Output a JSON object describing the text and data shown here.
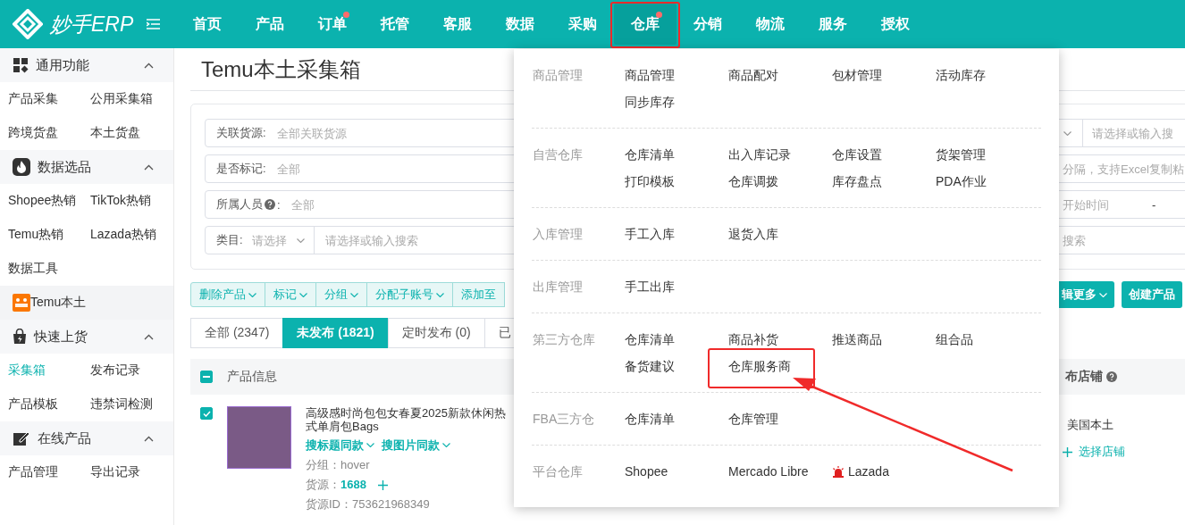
{
  "brand": "妙手ERP",
  "nav": [
    {
      "label": "首页",
      "selected": false,
      "dot": false,
      "highlighted": false
    },
    {
      "label": "产品",
      "selected": false,
      "dot": false,
      "highlighted": false
    },
    {
      "label": "订单",
      "selected": false,
      "dot": true,
      "highlighted": false
    },
    {
      "label": "托管",
      "selected": false,
      "dot": false,
      "highlighted": false
    },
    {
      "label": "客服",
      "selected": false,
      "dot": false,
      "highlighted": false
    },
    {
      "label": "数据",
      "selected": false,
      "dot": false,
      "highlighted": false
    },
    {
      "label": "采购",
      "selected": false,
      "dot": false,
      "highlighted": false
    },
    {
      "label": "仓库",
      "selected": true,
      "dot": true,
      "highlighted": true
    },
    {
      "label": "分销",
      "selected": false,
      "dot": false,
      "highlighted": false
    },
    {
      "label": "物流",
      "selected": false,
      "dot": false,
      "highlighted": false
    },
    {
      "label": "服务",
      "selected": false,
      "dot": false,
      "highlighted": false
    },
    {
      "label": "授权",
      "selected": false,
      "dot": false,
      "highlighted": false
    }
  ],
  "sidebar": [
    {
      "kind": "section",
      "title": "通用功能",
      "expanded": true,
      "items": [
        {
          "label": "产品采集",
          "selected": false
        },
        {
          "label": "公用采集箱",
          "selected": false
        },
        {
          "label": "跨境货盘",
          "selected": false
        },
        {
          "label": "本土货盘",
          "selected": false
        }
      ]
    },
    {
      "kind": "section",
      "title": "数据选品",
      "expanded": true,
      "items": [
        {
          "label": "Shopee热销",
          "selected": false
        },
        {
          "label": "TikTok热销",
          "selected": false
        },
        {
          "label": "Temu热销",
          "selected": false
        },
        {
          "label": "Lazada热销",
          "selected": false
        },
        {
          "label": "数据工具",
          "selected": false
        }
      ]
    },
    {
      "kind": "brand-link",
      "title": "Temu本土"
    },
    {
      "kind": "section",
      "title": "快速上货",
      "expanded": true,
      "items": [
        {
          "label": "采集箱",
          "selected": true
        },
        {
          "label": "发布记录",
          "selected": false
        },
        {
          "label": "产品模板",
          "selected": false
        },
        {
          "label": "违禁词检测",
          "selected": false
        }
      ]
    },
    {
      "kind": "section",
      "title": "在线产品",
      "expanded": true,
      "items": [
        {
          "label": "产品管理",
          "selected": false
        },
        {
          "label": "导出记录",
          "selected": false
        }
      ]
    }
  ],
  "page_title": "Temu本土采集箱",
  "filters": [
    {
      "kind": "select",
      "label": "关联货源:",
      "placeholder": "全部关联货源",
      "right": {
        "kind": "select-search",
        "placeholder": "请选择或输入搜"
      }
    },
    {
      "kind": "select",
      "label": "是否标记:",
      "placeholder": "全部",
      "right": {
        "kind": "text",
        "placeholder": "分隔，支持Excel复制粘"
      }
    },
    {
      "kind": "select",
      "label": "所属人员",
      "label_end": ":",
      "help": true,
      "placeholder": "全部",
      "right": {
        "kind": "date-range",
        "placeholder": "开始时间",
        "separator": "-"
      }
    },
    {
      "kind": "category",
      "label": "类目:",
      "select_placeholder": "请选择",
      "placeholder": "请选择或输入搜索",
      "right": {
        "kind": "text",
        "placeholder": "搜索"
      }
    }
  ],
  "actions": [
    {
      "label": "删除产品",
      "dropdown": true
    },
    {
      "label": "标记",
      "dropdown": true
    },
    {
      "label": "分组",
      "dropdown": true
    },
    {
      "label": "分配子账号",
      "dropdown": true
    },
    {
      "label": "添加至",
      "dropdown": false
    }
  ],
  "right_actions": [
    {
      "label": "辑更多",
      "dropdown": true
    },
    {
      "label": "创建产品",
      "dropdown": false
    }
  ],
  "tabs": [
    {
      "label": "全部 (2347)",
      "selected": false
    },
    {
      "label": "未发布 (1821)",
      "selected": true
    },
    {
      "label": "定时发布 (0)",
      "selected": false
    },
    {
      "label": "已",
      "selected": false
    }
  ],
  "table": {
    "header_indeterminate": true,
    "columns": [
      "产品信息"
    ],
    "right_column": "布店铺",
    "right_column_help": true,
    "rows": [
      {
        "checked": true,
        "title_lines": [
          "高级感时尚包包女春夏2025新款休闲热",
          "式单肩包Bags"
        ],
        "links": [
          "搜标题同款",
          "搜图片同款"
        ],
        "group_label": "分组：",
        "group": "hover",
        "source_label": "货源：",
        "source": "1688",
        "source_id_label": "货源ID：",
        "source_id": "753621968349",
        "store": "美国本土",
        "add_store": "选择店铺"
      }
    ]
  },
  "menu": [
    {
      "title": "商品管理",
      "items": [
        {
          "label": "商品管理",
          "kind": "plain",
          "highlighted": false
        },
        {
          "label": "商品配对",
          "kind": "plain",
          "highlighted": false
        },
        {
          "label": "包材管理",
          "kind": "plain",
          "highlighted": false
        },
        {
          "label": "活动库存",
          "kind": "plain",
          "highlighted": false
        },
        {
          "label": "同步库存",
          "kind": "plain",
          "highlighted": false
        }
      ]
    },
    {
      "title": "自营仓库",
      "items": [
        {
          "label": "仓库清单",
          "kind": "plain",
          "highlighted": false
        },
        {
          "label": "出入库记录",
          "kind": "plain",
          "highlighted": false
        },
        {
          "label": "仓库设置",
          "kind": "plain",
          "highlighted": false
        },
        {
          "label": "货架管理",
          "kind": "plain",
          "highlighted": false
        },
        {
          "label": "打印模板",
          "kind": "plain",
          "highlighted": false
        },
        {
          "label": "仓库调拨",
          "kind": "plain",
          "highlighted": false
        },
        {
          "label": "库存盘点",
          "kind": "plain",
          "highlighted": false
        },
        {
          "label": "PDA作业",
          "kind": "plain",
          "highlighted": false
        }
      ]
    },
    {
      "title": "入库管理",
      "items": [
        {
          "label": "手工入库",
          "kind": "plain",
          "highlighted": false
        },
        {
          "label": "退货入库",
          "kind": "plain",
          "highlighted": false
        }
      ]
    },
    {
      "title": "出库管理",
      "items": [
        {
          "label": "手工出库",
          "kind": "plain",
          "highlighted": false
        }
      ]
    },
    {
      "title": "第三方仓库",
      "items": [
        {
          "label": "仓库清单",
          "kind": "plain",
          "highlighted": false
        },
        {
          "label": "商品补货",
          "kind": "plain",
          "highlighted": false
        },
        {
          "label": "推送商品",
          "kind": "plain",
          "highlighted": false
        },
        {
          "label": "组合品",
          "kind": "plain",
          "highlighted": false
        },
        {
          "label": "备货建议",
          "kind": "plain",
          "highlighted": false
        },
        {
          "label": "仓库服务商",
          "kind": "plain",
          "highlighted": true
        }
      ]
    },
    {
      "title": "FBA三方仓",
      "items": [
        {
          "label": "仓库清单",
          "kind": "plain",
          "highlighted": false
        },
        {
          "label": "仓库管理",
          "kind": "plain",
          "highlighted": false
        }
      ]
    },
    {
      "title": "平台仓库",
      "items": [
        {
          "label": "Shopee",
          "kind": "plain",
          "highlighted": false
        },
        {
          "label": "Mercado Libre",
          "kind": "plain",
          "highlighted": false
        },
        {
          "label": "Lazada",
          "kind": "alert",
          "highlighted": false
        }
      ]
    }
  ]
}
